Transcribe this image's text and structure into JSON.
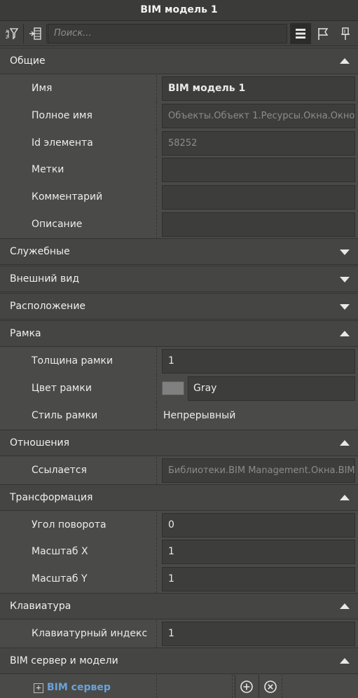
{
  "window": {
    "title": "BIM модель 1"
  },
  "toolbar": {
    "search_placeholder": "Поиск...",
    "icons": [
      "sort-filter-icon",
      "collapse-icon",
      "list-view-icon",
      "flag-icon",
      "pin-icon"
    ]
  },
  "sections": {
    "general": {
      "title": "Общие",
      "expanded": true,
      "name": {
        "label": "Имя",
        "value": "BIM модель 1"
      },
      "full_name": {
        "label": "Полное имя",
        "value": "Объекты.Объект 1.Ресурсы.Окна.Окно"
      },
      "element_id": {
        "label": "Id элемента",
        "value": "58252"
      },
      "tags": {
        "label": "Метки",
        "value": ""
      },
      "comment": {
        "label": "Комментарий",
        "value": ""
      },
      "description": {
        "label": "Описание",
        "value": ""
      }
    },
    "service": {
      "title": "Служебные",
      "expanded": false
    },
    "appearance": {
      "title": "Внешний вид",
      "expanded": false
    },
    "location": {
      "title": "Расположение",
      "expanded": false
    },
    "frame": {
      "title": "Рамка",
      "expanded": true,
      "thickness": {
        "label": "Толщина рамки",
        "value": "1"
      },
      "color": {
        "label": "Цвет рамки",
        "value": "Gray",
        "swatch": "#808080"
      },
      "style": {
        "label": "Стиль рамки",
        "value": "Непрерывный"
      }
    },
    "relations": {
      "title": "Отношения",
      "expanded": true,
      "refers": {
        "label": "Ссылается",
        "value": "Библиотеки.BIM Management.Окна.BIM"
      }
    },
    "transform": {
      "title": "Трансформация",
      "expanded": true,
      "rotation": {
        "label": "Угол поворота",
        "value": "0"
      },
      "scale_x": {
        "label": "Масштаб X",
        "value": "1"
      },
      "scale_y": {
        "label": "Масштаб Y",
        "value": "1"
      }
    },
    "keyboard": {
      "title": "Клавиатура",
      "expanded": true,
      "index": {
        "label": "Клавиатурный индекс",
        "value": "1"
      }
    },
    "bim": {
      "title": "BIM сервер и модели",
      "expanded": true,
      "server": {
        "label": "BIM сервер",
        "expand_symbol": "+"
      }
    }
  },
  "colors": {
    "background": "#4a4a48",
    "link": "#6aa3d8"
  }
}
